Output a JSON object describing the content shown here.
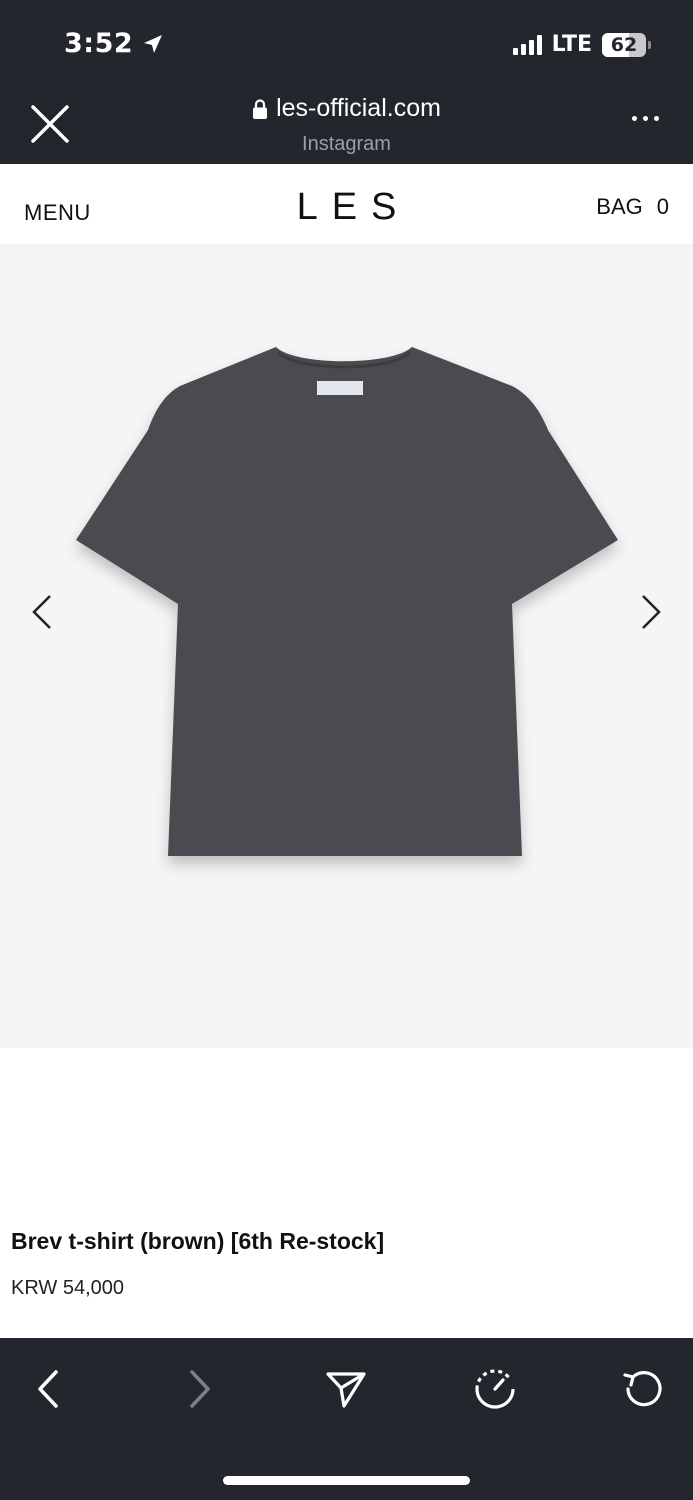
{
  "status_bar": {
    "time": "3:52",
    "network": "LTE",
    "battery": "62",
    "battery_level": 0.62,
    "location_icon": "location-arrow-icon",
    "signal_icon": "cellular-signal-icon"
  },
  "browser": {
    "url": "les-official.com",
    "source": "Instagram",
    "close_icon": "close-icon",
    "lock_icon": "lock-icon",
    "more_icon": "more-dots-icon"
  },
  "site_header": {
    "menu_label": "MENU",
    "logo": "LES",
    "bag_label": "BAG",
    "bag_count": "0"
  },
  "gallery": {
    "product_color": "#4e4a51",
    "background": "#f5f5f5",
    "prev_icon": "chevron-left-icon",
    "next_icon": "chevron-right-icon"
  },
  "product": {
    "title": "Brev t-shirt (brown) [6th Re-stock]",
    "price": "KRW 54,000"
  },
  "toolbar": {
    "back_icon": "back-arrow-icon",
    "forward_icon": "forward-arrow-icon",
    "share_icon": "send-icon",
    "speed_icon": "gauge-icon",
    "reload_icon": "reload-icon"
  }
}
